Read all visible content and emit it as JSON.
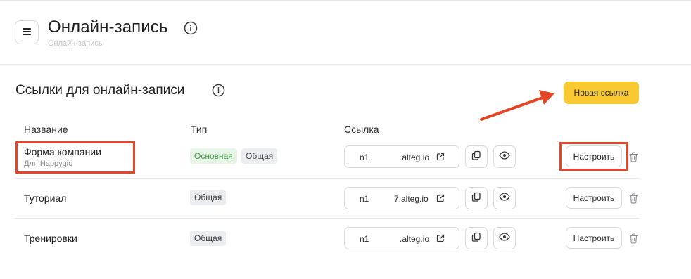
{
  "header": {
    "title": "Онлайн-запись",
    "breadcrumb": "Онлайн-запись"
  },
  "section": {
    "title": "Ссылки для онлайн-записи",
    "new_link_label": "Новая ссылка"
  },
  "table": {
    "columns": [
      "Название",
      "Тип",
      "Ссылка"
    ],
    "rows": [
      {
        "name": "Форма компании",
        "subtitle": "Для Happygio",
        "badges": [
          "Основная",
          "Общая"
        ],
        "link_prefix": "n1",
        "link_suffix": ".alteg.io",
        "configure_label": "Настроить"
      },
      {
        "name": "Туториал",
        "subtitle": "",
        "badges": [
          "Общая"
        ],
        "link_prefix": "n1",
        "link_suffix": "7.alteg.io",
        "configure_label": "Настроить"
      },
      {
        "name": "Тренировки",
        "subtitle": "",
        "badges": [
          "Общая"
        ],
        "link_prefix": "n1",
        "link_suffix": ".alteg.io",
        "configure_label": "Настроить"
      }
    ]
  },
  "colors": {
    "accent": "#f8c930",
    "annotation": "#e64626",
    "badge_green_bg": "#e7f5e7",
    "badge_green_text": "#3d9a3f",
    "badge_gray_bg": "#ebedf0"
  },
  "icons": {
    "menu": "hamburger-icon",
    "info": "info-icon",
    "external": "external-link-icon",
    "copy": "copy-icon",
    "preview": "eye-icon",
    "delete": "trash-icon"
  }
}
